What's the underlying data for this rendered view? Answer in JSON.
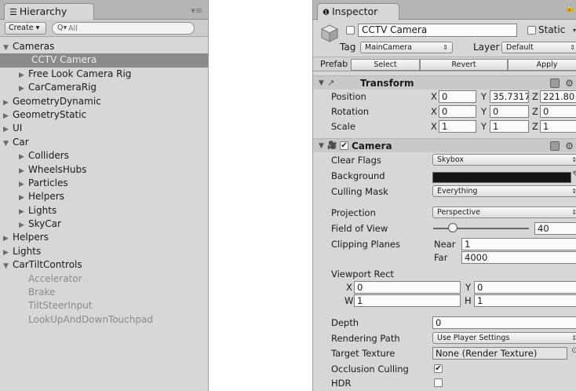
{
  "hierarchy": {
    "tab_icon": "list-icon",
    "title": "Hierarchy",
    "menu_glyph": "▾≡",
    "create_label": "Create",
    "create_arrow": "▾",
    "search_glyph": "Q▾",
    "search_placeholder": "All",
    "items": [
      {
        "arrow": "▼",
        "label": "Cameras",
        "level": 0
      },
      {
        "arrow": "",
        "label": "CCTV Camera",
        "level": 1,
        "selected": true
      },
      {
        "arrow": "▶",
        "label": "Free Look Camera Rig",
        "level": 1
      },
      {
        "arrow": "▶",
        "label": "CarCameraRig",
        "level": 1
      },
      {
        "arrow": "▶",
        "label": "GeometryDynamic",
        "level": 0
      },
      {
        "arrow": "▶",
        "label": "GeometryStatic",
        "level": 0
      },
      {
        "arrow": "▶",
        "label": "UI",
        "level": 0
      },
      {
        "arrow": "▼",
        "label": "Car",
        "level": 0
      },
      {
        "arrow": "▶",
        "label": "Colliders",
        "level": 1
      },
      {
        "arrow": "▶",
        "label": "WheelsHubs",
        "level": 1
      },
      {
        "arrow": "▶",
        "label": "Particles",
        "level": 1
      },
      {
        "arrow": "▶",
        "label": "Helpers",
        "level": 1
      },
      {
        "arrow": "▶",
        "label": "Lights",
        "level": 1
      },
      {
        "arrow": "▶",
        "label": "SkyCar",
        "level": 1
      },
      {
        "arrow": "▶",
        "label": "Helpers",
        "level": 0
      },
      {
        "arrow": "▶",
        "label": "Lights",
        "level": 0
      },
      {
        "arrow": "▼",
        "label": "CarTiltControls",
        "level": 0
      },
      {
        "arrow": "",
        "label": "Accelerator",
        "level": 1,
        "grey": true
      },
      {
        "arrow": "",
        "label": "Brake",
        "level": 1,
        "grey": true
      },
      {
        "arrow": "",
        "label": "TiltSteerInput",
        "level": 1,
        "grey": true
      },
      {
        "arrow": "",
        "label": "LookUpAndDownTouchpad",
        "level": 1,
        "grey": true
      }
    ]
  },
  "inspector": {
    "tab_icon": "info-icon",
    "tab_glyph": "❶",
    "title": "Inspector",
    "lock_glyph": "🔒",
    "object_name": "CCTV Camera",
    "static_label": "Static",
    "static_arrow": "▾",
    "tag_label": "Tag",
    "tag_value": "MainCamera",
    "layer_label": "Layer",
    "layer_value": "Default",
    "prefab_label": "Prefab",
    "prefab_select": "Select",
    "prefab_revert": "Revert",
    "prefab_apply": "Apply",
    "transform": {
      "fold": "▼",
      "icon": "↗",
      "title": "Transform",
      "gear": "⚙",
      "position_label": "Position",
      "rotation_label": "Rotation",
      "scale_label": "Scale",
      "x": "X",
      "y": "Y",
      "z": "Z",
      "position": [
        "0",
        "35.7317",
        "221.80"
      ],
      "rotation": [
        "0",
        "0",
        "0"
      ],
      "scale": [
        "1",
        "1",
        "1"
      ]
    },
    "camera": {
      "fold": "▼",
      "icon": "🎥",
      "check": "✔",
      "title": "Camera",
      "gear": "⚙",
      "clear_flags_label": "Clear Flags",
      "clear_flags_value": "Skybox",
      "background_label": "Background",
      "background_color": "#141414",
      "culling_mask_label": "Culling Mask",
      "culling_mask_value": "Everything",
      "projection_label": "Projection",
      "projection_value": "Perspective",
      "fov_label": "Field of View",
      "fov_value": "40",
      "clipping_label": "Clipping Planes",
      "near_label": "Near",
      "near_value": "1",
      "far_label": "Far",
      "far_value": "4000",
      "viewport_label": "Viewport Rect",
      "vx_label": "X",
      "vx_value": "0",
      "vy_label": "Y",
      "vy_value": "0",
      "vw_label": "W",
      "vw_value": "1",
      "vh_label": "H",
      "vh_value": "1",
      "depth_label": "Depth",
      "depth_value": "0",
      "rendering_path_label": "Rendering Path",
      "rendering_path_value": "Use Player Settings",
      "target_texture_label": "Target Texture",
      "target_texture_value": "None (Render Texture)",
      "target_glyph": "⊙",
      "occlusion_label": "Occlusion Culling",
      "occlusion_check": "✔",
      "hdr_label": "HDR",
      "hdr_check": ""
    }
  }
}
